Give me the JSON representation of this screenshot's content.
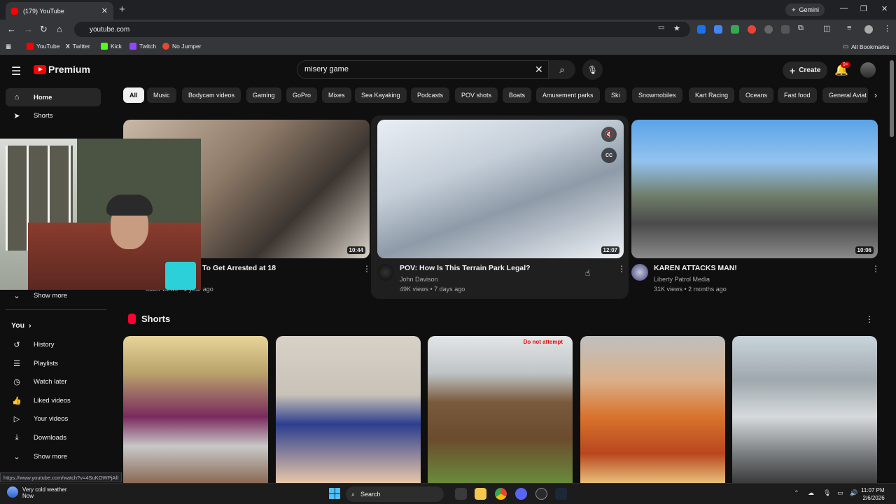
{
  "browser": {
    "tab_title": "(179) YouTube",
    "tab_close": "✕",
    "new_tab": "+",
    "gemini_label": "Gemini",
    "address": "youtube.com",
    "bookmarks": [
      {
        "label": "YouTube",
        "color": "#ff0000"
      },
      {
        "label": "Twitter",
        "color": "#e8eaed"
      },
      {
        "label": "Kick",
        "color": "#53fc18"
      },
      {
        "label": "Twitch",
        "color": "#9146ff"
      },
      {
        "label": "No Jumper",
        "color": "#e04a2f"
      }
    ],
    "all_bookmarks": "All Bookmarks",
    "status_url": "https://www.youtube.com/watch?v=4SuKOWPjAfI"
  },
  "header": {
    "logo_text": "Premium",
    "search_value": "misery game",
    "create_label": "Create",
    "notif_count": "9+"
  },
  "sidebar": {
    "items": [
      {
        "label": "Home",
        "icon": "home-icon",
        "glyph": "⌂"
      },
      {
        "label": "Shorts",
        "icon": "shorts-icon",
        "glyph": "➤"
      }
    ],
    "show_more_1": "Show more",
    "you_label": "You",
    "you_items": [
      {
        "label": "History",
        "icon": "history-icon",
        "glyph": "↺"
      },
      {
        "label": "Playlists",
        "icon": "playlists-icon",
        "glyph": "☰"
      },
      {
        "label": "Watch later",
        "icon": "watch-later-icon",
        "glyph": "◷"
      },
      {
        "label": "Liked videos",
        "icon": "like-icon",
        "glyph": "👍"
      },
      {
        "label": "Your videos",
        "icon": "your-videos-icon",
        "glyph": "▷"
      },
      {
        "label": "Downloads",
        "icon": "download-icon",
        "glyph": "⤓"
      }
    ],
    "show_more_2": "Show more"
  },
  "chips": [
    "All",
    "Music",
    "Bodycam videos",
    "Gaming",
    "GoPro",
    "Mixes",
    "Sea Kayaking",
    "Podcasts",
    "POV shots",
    "Boats",
    "Amusement parks",
    "Ski",
    "Snowmobiles",
    "Kart Racing",
    "Oceans",
    "Fast food",
    "General Aviat"
  ],
  "videos": [
    {
      "title": "To Get Arrested at 18",
      "channel": "",
      "meta": "633K views • 1 year ago",
      "duration": "10:44"
    },
    {
      "title": "POV: How Is This Terrain Park Legal?",
      "channel": "John Davison",
      "meta": "49K views • 7 days ago",
      "duration": "12:07"
    },
    {
      "title": "KAREN ATTACKS MAN!",
      "channel": "Liberty Patrol Media",
      "meta": "31K views • 2 months ago",
      "duration": "10:06"
    }
  ],
  "shorts": {
    "label": "Shorts",
    "overlay_text": "Do not attempt"
  },
  "taskbar": {
    "weather": "Very cold weather",
    "weather_sub": "Now",
    "search_label": "Search",
    "time": "11:07 PM",
    "date": "2/6/2026"
  }
}
